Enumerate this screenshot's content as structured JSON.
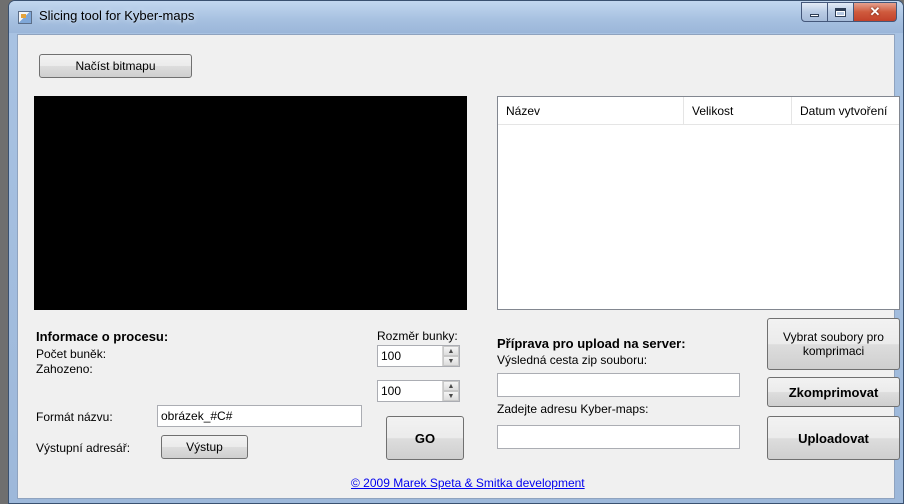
{
  "window": {
    "title": "Slicing tool for Kyber-maps"
  },
  "toolbar": {
    "load_bitmap_label": "Načíst bitmapu"
  },
  "file_list": {
    "columns": [
      "Název",
      "Velikost",
      "Datum vytvoření"
    ],
    "rows": []
  },
  "process_info": {
    "heading": "Informace o procesu:",
    "cell_count_label": "Počet buněk:",
    "discarded_label": "Zahozeno:"
  },
  "cell_size": {
    "label": "Rozměr bunky:",
    "width_value": "100",
    "height_value": "100"
  },
  "name_format": {
    "label": "Formát názvu:",
    "value": "obrázek_#C#"
  },
  "output_dir": {
    "label": "Výstupní adresář:",
    "button_label": "Výstup"
  },
  "go_button_label": "GO",
  "upload": {
    "heading": "Příprava pro upload na server:",
    "zip_path_label": "Výsledná cesta zip souboru:",
    "zip_path_value": "",
    "kyber_address_label": "Zadejte adresu Kyber-maps:",
    "kyber_address_value": "",
    "select_files_label": "Vybrat soubory pro komprimaci",
    "compress_label": "Zkomprimovat",
    "upload_label": "Uploadovat"
  },
  "footer": {
    "copyright_link": "© 2009 Marek Speta & Smitka development"
  },
  "colors": {
    "titlebar": "#a6c0e0",
    "client_background": "#f0f0f0",
    "canvas": "#000000",
    "link": "#0000ee"
  }
}
